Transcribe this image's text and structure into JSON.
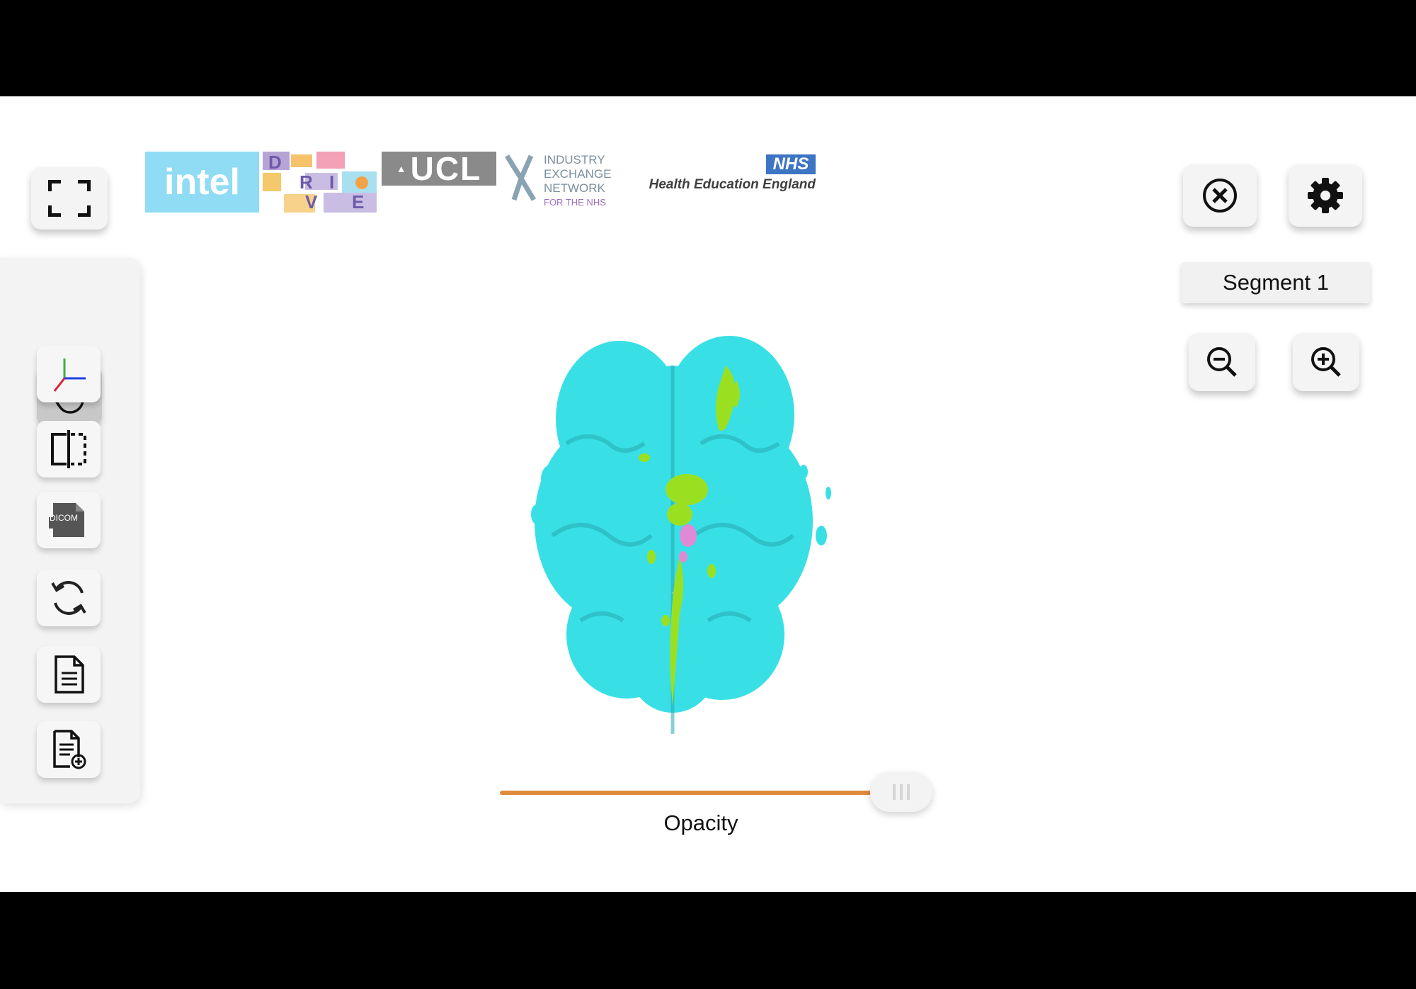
{
  "logos": {
    "intel": "intel",
    "drive": [
      "D",
      "R",
      "I",
      "V",
      "E"
    ],
    "ucl": "UCL",
    "iex": [
      "INDUSTRY",
      "EXCHANGE",
      "NETWORK",
      "FOR THE NHS"
    ],
    "nhs": "NHS",
    "hee": "Health Education England"
  },
  "toolbar": {
    "dicom_label": "DICOM"
  },
  "segment": {
    "label": "Segment 1"
  },
  "opacity": {
    "label": "Opacity",
    "value": 0.98
  },
  "colors": {
    "accent_track": "#e08a3c",
    "brain": "#38e0e6",
    "vessel": "#9be020"
  },
  "icons": [
    "fullscreen-icon",
    "hand-icon",
    "axes-icon",
    "split-view-icon",
    "dicom-file-icon",
    "refresh-icon",
    "document-icon",
    "document-add-icon",
    "close-icon",
    "gear-icon",
    "zoom-out-icon",
    "zoom-in-icon"
  ]
}
